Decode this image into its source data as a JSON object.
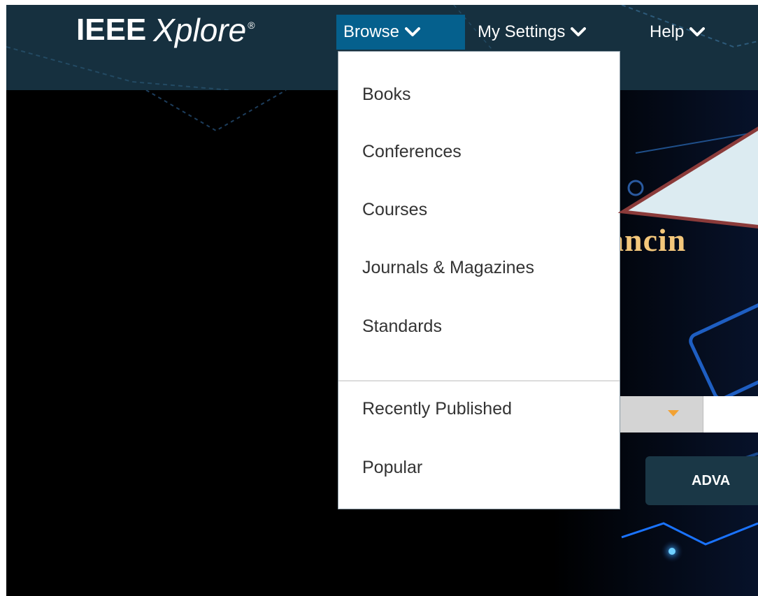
{
  "logo": {
    "ieee": "IEEE",
    "xplore": "Xplore",
    "registered": "®"
  },
  "nav": {
    "browse": "Browse",
    "my_settings": "My Settings",
    "help": "Help"
  },
  "browse_menu": {
    "items": [
      "Books",
      "Conferences",
      "Courses",
      "Journals & Magazines",
      "Standards"
    ],
    "secondary_items": [
      "Recently Published",
      "Popular"
    ]
  },
  "hero": {
    "headline_fragment": "ancin",
    "advanced_button_fragment": "ADVA"
  },
  "colors": {
    "topbar": "#16303f",
    "browse_active": "#05608d",
    "hero_text": "#f3c77b",
    "callout_fill": "#dcebf1",
    "callout_border": "#8b3b3a"
  },
  "icons": {
    "nav_chevron": "chevron-down-icon",
    "search_type_arrow": "caret-down-icon"
  }
}
